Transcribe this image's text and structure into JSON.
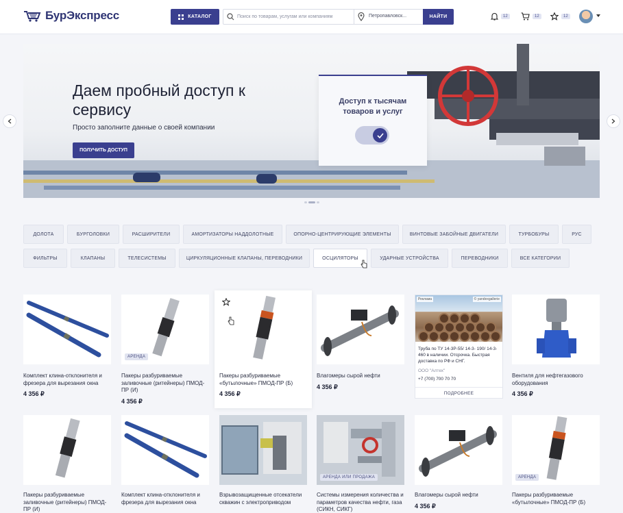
{
  "header": {
    "logo_text": "БурЭкспресс",
    "catalog_label": "КАТАЛОГ",
    "search_placeholder": "Поиск по товарам, услугам или компаниям",
    "location": "Петропавловск...",
    "find_label": "НАЙТИ",
    "notifications_count": "12",
    "cart_count": "12",
    "favorites_count": "12",
    "brand_color": "#3a3f8f"
  },
  "banner": {
    "title": "Даем пробный доступ к сервису",
    "subtitle": "Просто заполните данные о своей компании",
    "button_label": "ПОЛУЧИТЬ ДОСТУП",
    "card_text": "Доступ к тысячам товаров и услуг",
    "slide_count": 3,
    "active_slide": 2
  },
  "categories": {
    "row1": [
      "ДОЛОТА",
      "БУРГОЛОВКИ",
      "РАСШИРИТЕЛИ",
      "АМОРТИЗАТОРЫ НАДДОЛОТНЫЕ",
      "ОПОРНО-ЦЕНТРИРУЮЩИЕ ЭЛЕМЕНТЫ",
      "ВИНТОВЫЕ ЗАБОЙНЫЕ ДВИГАТЕЛИ",
      "ТУРБОБУРЫ",
      "РУС"
    ],
    "row2": [
      "ФИЛЬТРЫ",
      "КЛАПАНЫ",
      "ТЕЛЕСИСТЕМЫ",
      "ЦИРКУЛЯЦИОННЫЕ КЛАПАНЫ, ПЕРЕВОДНИКИ",
      "ОСЦИЛЯТОРЫ",
      "УДАРНЫЕ УСТРОЙСТВА",
      "ПЕРЕВОДНИКИ",
      "ВСЕ КАТЕГОРИИ"
    ]
  },
  "products_row1": [
    {
      "title": "Комплект клина-отклонителя и фрезера для вырезания окна",
      "price": "4 356 ₽",
      "tag": ""
    },
    {
      "title": "Пакеры разбуриваемые заливочные (ритейнеры) ПМОД-ПР (И)",
      "price": "4 356 ₽",
      "tag": "АРЕНДА"
    },
    {
      "title": "Пакеры разбуриваемые «бутылочные» ПМОД-ПР (Б)",
      "price": "4 356 ₽",
      "tag": ""
    },
    {
      "title": "Влагомеры сырой нефти",
      "price": "4 356 ₽",
      "tag": ""
    },
    {
      "title": "Вентиля для нефтегазового оборудования",
      "price": "4 356 ₽",
      "tag": ""
    }
  ],
  "ad": {
    "label": "Реклама",
    "source": "© yandexgallerie",
    "description": "Труба по ТУ 14-3Р-55/ 14-3- 190/ 14-3-460 в наличии. Отсрочка. Быстрая доставка по РФ и СНГ.",
    "company": "ООО \"Алтех\"",
    "phone": "+7 (700) 700 70 70",
    "more_label": "ПОДРОБНЕЕ"
  },
  "products_row2": [
    {
      "title": "Пакеры разбуриваемые заливочные (ритейнеры) ПМОД-ПР (И)",
      "price": "",
      "tag": ""
    },
    {
      "title": "Комплект клина-отклонителя и фрезера для вырезания окна",
      "price": "",
      "tag": ""
    },
    {
      "title": "Взрывозащищенные отсекатели скважин с электроприводом",
      "price": "",
      "tag": ""
    },
    {
      "title": "Системы измерения количества и параметров качества нефти, газа (СИКН, СИКГ)",
      "price": "",
      "tag": "АРЕНДА ИЛИ ПРОДАЖА"
    },
    {
      "title": "Влагомеры сырой нефти",
      "price": "4 356 ₽",
      "tag": ""
    },
    {
      "title": "Пакеры разбуриваемые «бутылочные» ПМОД-ПР (Б)",
      "price": "",
      "tag": "АРЕНДА"
    }
  ]
}
